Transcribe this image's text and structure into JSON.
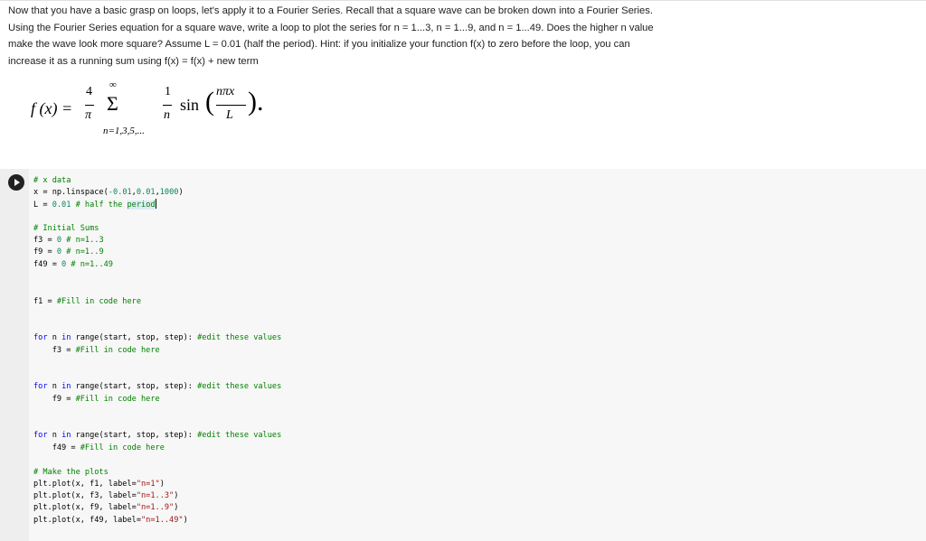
{
  "question": {
    "line1": "Now that you have a basic grasp on loops, let's apply it to a Fourier Series. Recall that a square wave can be broken down into a Fourier Series.",
    "line2": "Using the Fourier Series equation for a square wave, write a loop to plot the series for n = 1...3, n = 1...9, and n = 1...49. Does the higher n value",
    "line3": "make the wave look more square? Assume L = 0.01 (half the period). Hint: if you initialize your function f(x) to zero before the loop, you can",
    "line4": "increase it as a running sum using f(x) = f(x) + new term"
  },
  "formula": {
    "lhs": "f (x) =",
    "four": "4",
    "pi": "π",
    "sigma": "Σ",
    "infinity": "∞",
    "lower_limit": "n=1,3,5,...",
    "one": "1",
    "n": "n",
    "sin": "sin",
    "open_paren": "(",
    "numerator": "nπx",
    "denominator": "L",
    "close_paren": ")."
  },
  "code": {
    "l1_comment": "# x data",
    "l2_a": "x = np.linspace(",
    "l2_n1": "-0.01",
    "l2_b": ",",
    "l2_n2": "0.01",
    "l2_c": ",",
    "l2_n3": "1000",
    "l2_d": ")",
    "l3_a": "L = ",
    "l3_num": "0.01",
    "l3_comment_a": " # half the ",
    "l3_comment_b": "period",
    "l4_comment": "# Initial Sums",
    "l5_a": "f3 = ",
    "l5_num": "0",
    "l5_comment": " # n=1..3",
    "l6_a": "f9 = ",
    "l6_num": "0",
    "l6_comment": " # n=1..9",
    "l7_a": "f49 = ",
    "l7_num": "0",
    "l7_comment": " # n=1..49",
    "l8_a": "f1 = ",
    "l8_comment": "#Fill in code here",
    "loop_for": "for",
    "loop_mid": " n ",
    "loop_in": "in",
    "loop_rest": " range(start, stop, step): ",
    "loop_comment": "#edit these values",
    "body3_a": "    f3 = ",
    "body9_a": "    f9 = ",
    "body49_a": "    f49 = ",
    "body_comment": "#Fill in code here",
    "plots_comment": "# Make the plots",
    "p1_a": "plt.plot(x, f1, label=",
    "p1_s": "\"n=1\"",
    "p2_a": "plt.plot(x, f3, label=",
    "p2_s": "\"n=1..3\"",
    "p3_a": "plt.plot(x, f9, label=",
    "p3_s": "\"n=1..9\"",
    "p4_a": "plt.plot(x, f49, label=",
    "p4_s": "\"n=1..49\"",
    "close": ")"
  }
}
